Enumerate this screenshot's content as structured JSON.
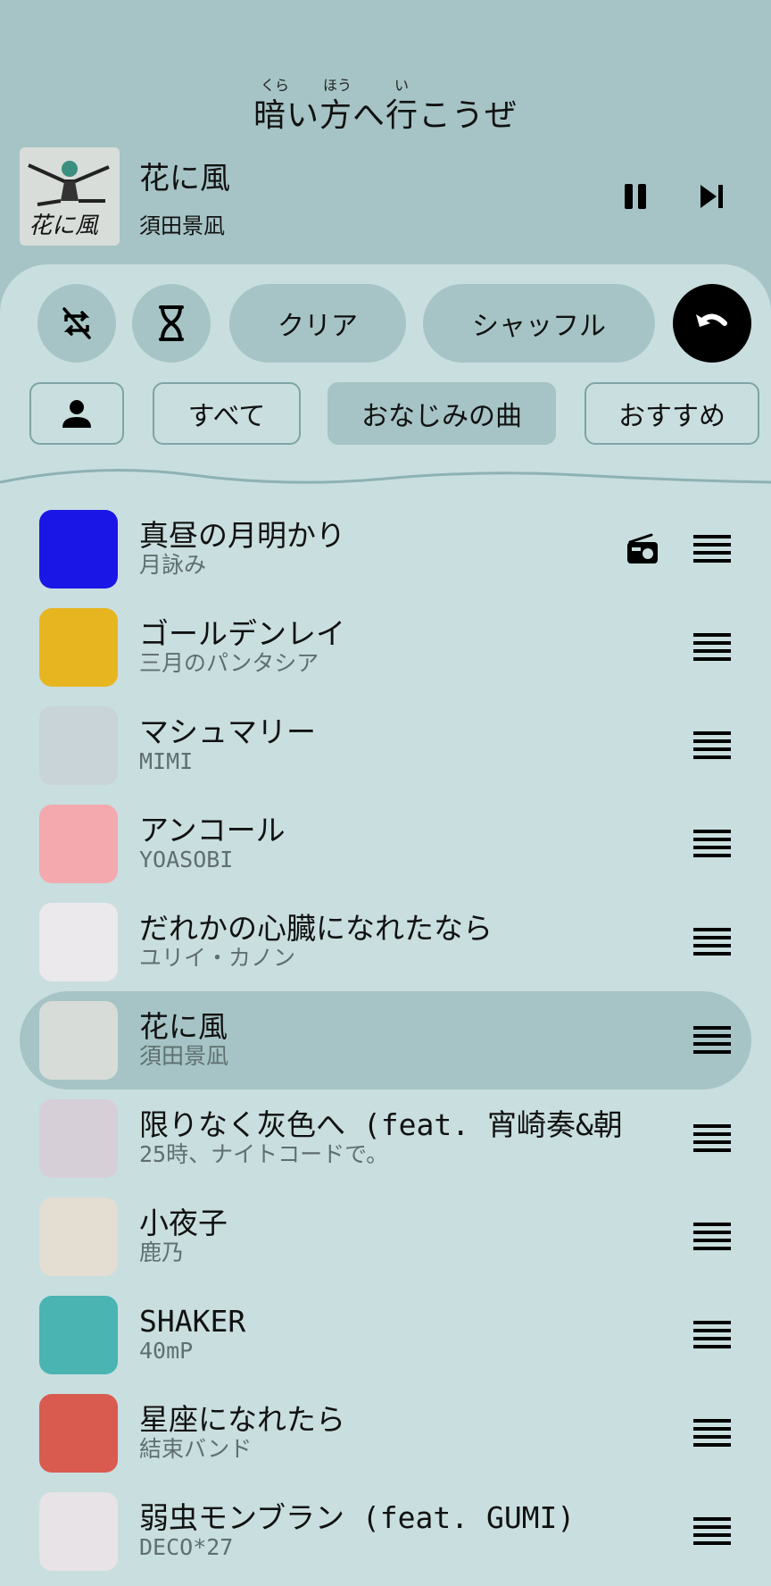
{
  "lyric": {
    "text": "暗い方へ行こうぜ",
    "ruby": [
      "くら",
      "ほう",
      "い"
    ]
  },
  "now_playing": {
    "title": "花に風",
    "artist": "須田景凪"
  },
  "controls": {
    "clear_label": "クリア",
    "shuffle_label": "シャッフル"
  },
  "filters": {
    "all_label": "すべて",
    "familiar_label": "おなじみの曲",
    "recommended_label": "おすすめ"
  },
  "queue": [
    {
      "title": "真昼の月明かり",
      "artist": "月詠み",
      "color": "#1a16e6"
    },
    {
      "title": "ゴールデンレイ",
      "artist": "三月のパンタシア",
      "color": "#e7b520"
    },
    {
      "title": "マシュマリー",
      "artist": "MIMI",
      "color": "#c8d4d8"
    },
    {
      "title": "アンコール",
      "artist": "YOASOBI",
      "color": "#f3a9ae"
    },
    {
      "title": "だれかの心臓になれたなら",
      "artist": "ユリイ・カノン",
      "color": "#ebe9ec"
    },
    {
      "title": "花に風",
      "artist": "須田景凪",
      "color": "#d7dcd8"
    },
    {
      "title": "限りなく灰色へ (feat. 宵崎奏&朝",
      "artist": "25時、ナイトコードで。",
      "color": "#d6cfd8"
    },
    {
      "title": "小夜子",
      "artist": "鹿乃",
      "color": "#e3ddd2"
    },
    {
      "title": "SHAKER",
      "artist": "40mP",
      "color": "#49b4b2"
    },
    {
      "title": "星座になれたら",
      "artist": "結束バンド",
      "color": "#d95a4f"
    },
    {
      "title": "弱虫モンブラン (feat. GUMI)",
      "artist": "DECO*27",
      "color": "#e8e3e6"
    }
  ]
}
